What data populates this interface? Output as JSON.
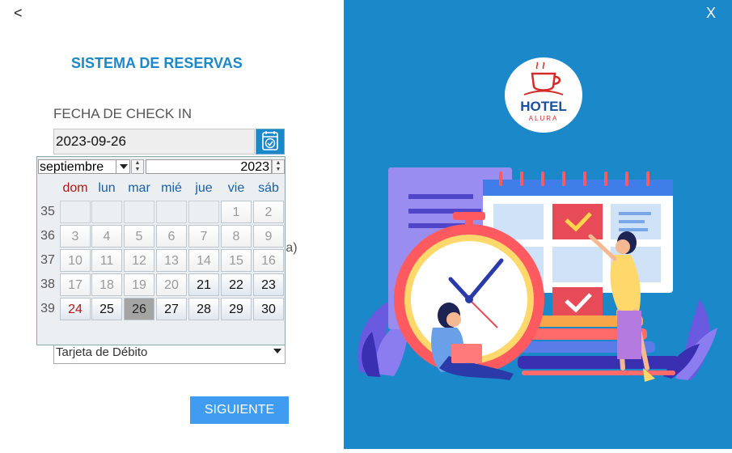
{
  "nav": {
    "back_label": "<",
    "close_label": "X"
  },
  "form": {
    "title": "SISTEMA DE RESERVAS",
    "checkin_label": "FECHA DE CHECK IN",
    "checkin_value": "2023-09-26",
    "partial_label": "día)",
    "payment_value": "Tarjeta de Débito",
    "next_label": "SIGUIENTE"
  },
  "calendar": {
    "month": "septiembre",
    "year": "2023",
    "day_headers": [
      "dom",
      "lun",
      "mar",
      "mié",
      "jue",
      "vie",
      "sáb"
    ],
    "weeks": [
      {
        "num": "35",
        "days": [
          "",
          "",
          "",
          "",
          "",
          "1",
          "2"
        ]
      },
      {
        "num": "36",
        "days": [
          "3",
          "4",
          "5",
          "6",
          "7",
          "8",
          "9"
        ]
      },
      {
        "num": "37",
        "days": [
          "10",
          "11",
          "12",
          "13",
          "14",
          "15",
          "16"
        ]
      },
      {
        "num": "38",
        "days": [
          "17",
          "18",
          "19",
          "20",
          "21",
          "22",
          "23"
        ]
      },
      {
        "num": "39",
        "days": [
          "24",
          "25",
          "26",
          "27",
          "28",
          "29",
          "30"
        ]
      }
    ],
    "selected_day": "26",
    "disabled_before": "21"
  },
  "logo": {
    "line1": "HOTEL",
    "line2": "ALURA"
  },
  "colors": {
    "accent": "#1a88c9",
    "button": "#3f9cf0",
    "sunday": "#b31616"
  }
}
